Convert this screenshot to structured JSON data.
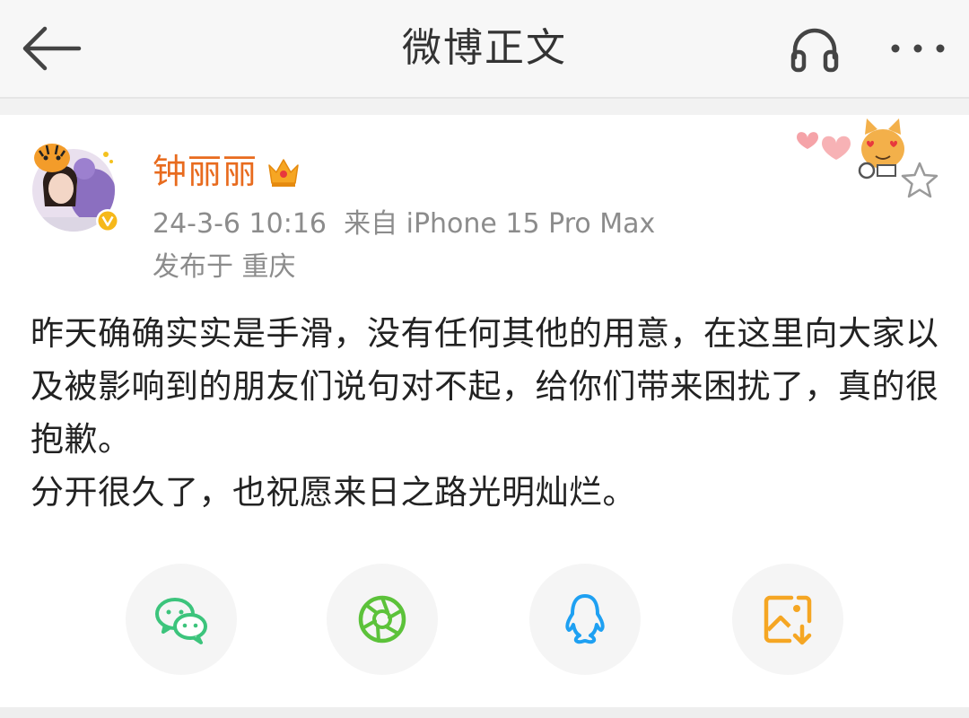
{
  "header": {
    "title": "微博正文",
    "back_icon": "arrow-left-icon",
    "listen_icon": "headphones-icon",
    "more_icon": "more-dots-icon"
  },
  "post": {
    "author": "钟丽丽",
    "badge_icon": "crown-icon",
    "verified_icon": "verified-v-icon",
    "date": "24-3-6 10:16",
    "source": "来自 iPhone 15 Pro Max",
    "location": "发布于 重庆",
    "paragraphs": [
      "昨天确确实实是手滑，没有任何其他的用意，在这里向大家以及被影响到的朋友们说句对不起，给你们带来困扰了，真的很抱歉。",
      "分开很久了，也祝愿来日之路光明灿烂。"
    ]
  },
  "share": [
    {
      "name": "wechat",
      "icon": "wechat-icon",
      "color": "#3cc47c"
    },
    {
      "name": "moments",
      "icon": "moments-aperture-icon",
      "color": "#5cc23a"
    },
    {
      "name": "qq",
      "icon": "qq-penguin-icon",
      "color": "#1ea0f2"
    },
    {
      "name": "save-image",
      "icon": "save-image-icon",
      "color": "#f5a623"
    }
  ],
  "colors": {
    "username": "#e86b1e",
    "meta": "#8c8c8c",
    "header_bg": "#f7f7f7"
  }
}
